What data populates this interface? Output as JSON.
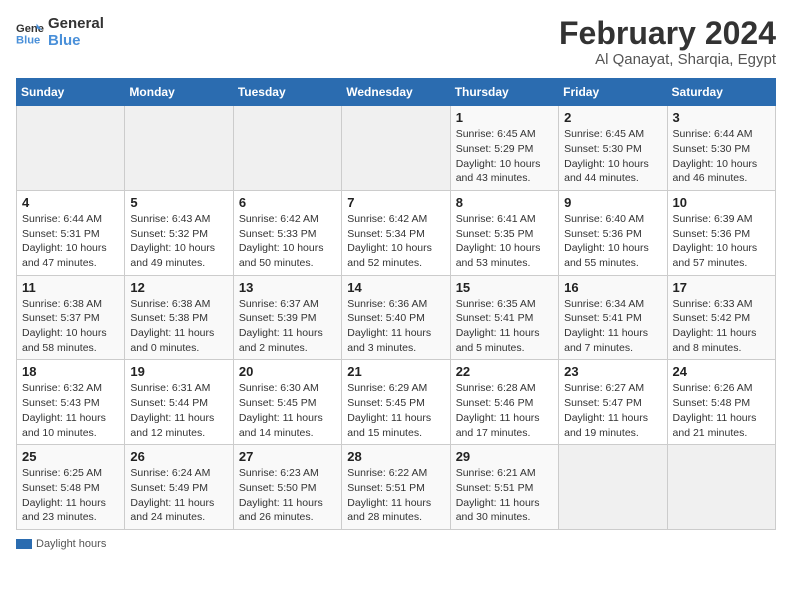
{
  "header": {
    "logo_line1": "General",
    "logo_line2": "Blue",
    "month": "February 2024",
    "location": "Al Qanayat, Sharqia, Egypt"
  },
  "weekdays": [
    "Sunday",
    "Monday",
    "Tuesday",
    "Wednesday",
    "Thursday",
    "Friday",
    "Saturday"
  ],
  "weeks": [
    [
      {
        "day": "",
        "sunrise": "",
        "sunset": "",
        "daylight": ""
      },
      {
        "day": "",
        "sunrise": "",
        "sunset": "",
        "daylight": ""
      },
      {
        "day": "",
        "sunrise": "",
        "sunset": "",
        "daylight": ""
      },
      {
        "day": "",
        "sunrise": "",
        "sunset": "",
        "daylight": ""
      },
      {
        "day": "1",
        "sunrise": "Sunrise: 6:45 AM",
        "sunset": "Sunset: 5:29 PM",
        "daylight": "Daylight: 10 hours and 43 minutes."
      },
      {
        "day": "2",
        "sunrise": "Sunrise: 6:45 AM",
        "sunset": "Sunset: 5:30 PM",
        "daylight": "Daylight: 10 hours and 44 minutes."
      },
      {
        "day": "3",
        "sunrise": "Sunrise: 6:44 AM",
        "sunset": "Sunset: 5:30 PM",
        "daylight": "Daylight: 10 hours and 46 minutes."
      }
    ],
    [
      {
        "day": "4",
        "sunrise": "Sunrise: 6:44 AM",
        "sunset": "Sunset: 5:31 PM",
        "daylight": "Daylight: 10 hours and 47 minutes."
      },
      {
        "day": "5",
        "sunrise": "Sunrise: 6:43 AM",
        "sunset": "Sunset: 5:32 PM",
        "daylight": "Daylight: 10 hours and 49 minutes."
      },
      {
        "day": "6",
        "sunrise": "Sunrise: 6:42 AM",
        "sunset": "Sunset: 5:33 PM",
        "daylight": "Daylight: 10 hours and 50 minutes."
      },
      {
        "day": "7",
        "sunrise": "Sunrise: 6:42 AM",
        "sunset": "Sunset: 5:34 PM",
        "daylight": "Daylight: 10 hours and 52 minutes."
      },
      {
        "day": "8",
        "sunrise": "Sunrise: 6:41 AM",
        "sunset": "Sunset: 5:35 PM",
        "daylight": "Daylight: 10 hours and 53 minutes."
      },
      {
        "day": "9",
        "sunrise": "Sunrise: 6:40 AM",
        "sunset": "Sunset: 5:36 PM",
        "daylight": "Daylight: 10 hours and 55 minutes."
      },
      {
        "day": "10",
        "sunrise": "Sunrise: 6:39 AM",
        "sunset": "Sunset: 5:36 PM",
        "daylight": "Daylight: 10 hours and 57 minutes."
      }
    ],
    [
      {
        "day": "11",
        "sunrise": "Sunrise: 6:38 AM",
        "sunset": "Sunset: 5:37 PM",
        "daylight": "Daylight: 10 hours and 58 minutes."
      },
      {
        "day": "12",
        "sunrise": "Sunrise: 6:38 AM",
        "sunset": "Sunset: 5:38 PM",
        "daylight": "Daylight: 11 hours and 0 minutes."
      },
      {
        "day": "13",
        "sunrise": "Sunrise: 6:37 AM",
        "sunset": "Sunset: 5:39 PM",
        "daylight": "Daylight: 11 hours and 2 minutes."
      },
      {
        "day": "14",
        "sunrise": "Sunrise: 6:36 AM",
        "sunset": "Sunset: 5:40 PM",
        "daylight": "Daylight: 11 hours and 3 minutes."
      },
      {
        "day": "15",
        "sunrise": "Sunrise: 6:35 AM",
        "sunset": "Sunset: 5:41 PM",
        "daylight": "Daylight: 11 hours and 5 minutes."
      },
      {
        "day": "16",
        "sunrise": "Sunrise: 6:34 AM",
        "sunset": "Sunset: 5:41 PM",
        "daylight": "Daylight: 11 hours and 7 minutes."
      },
      {
        "day": "17",
        "sunrise": "Sunrise: 6:33 AM",
        "sunset": "Sunset: 5:42 PM",
        "daylight": "Daylight: 11 hours and 8 minutes."
      }
    ],
    [
      {
        "day": "18",
        "sunrise": "Sunrise: 6:32 AM",
        "sunset": "Sunset: 5:43 PM",
        "daylight": "Daylight: 11 hours and 10 minutes."
      },
      {
        "day": "19",
        "sunrise": "Sunrise: 6:31 AM",
        "sunset": "Sunset: 5:44 PM",
        "daylight": "Daylight: 11 hours and 12 minutes."
      },
      {
        "day": "20",
        "sunrise": "Sunrise: 6:30 AM",
        "sunset": "Sunset: 5:45 PM",
        "daylight": "Daylight: 11 hours and 14 minutes."
      },
      {
        "day": "21",
        "sunrise": "Sunrise: 6:29 AM",
        "sunset": "Sunset: 5:45 PM",
        "daylight": "Daylight: 11 hours and 15 minutes."
      },
      {
        "day": "22",
        "sunrise": "Sunrise: 6:28 AM",
        "sunset": "Sunset: 5:46 PM",
        "daylight": "Daylight: 11 hours and 17 minutes."
      },
      {
        "day": "23",
        "sunrise": "Sunrise: 6:27 AM",
        "sunset": "Sunset: 5:47 PM",
        "daylight": "Daylight: 11 hours and 19 minutes."
      },
      {
        "day": "24",
        "sunrise": "Sunrise: 6:26 AM",
        "sunset": "Sunset: 5:48 PM",
        "daylight": "Daylight: 11 hours and 21 minutes."
      }
    ],
    [
      {
        "day": "25",
        "sunrise": "Sunrise: 6:25 AM",
        "sunset": "Sunset: 5:48 PM",
        "daylight": "Daylight: 11 hours and 23 minutes."
      },
      {
        "day": "26",
        "sunrise": "Sunrise: 6:24 AM",
        "sunset": "Sunset: 5:49 PM",
        "daylight": "Daylight: 11 hours and 24 minutes."
      },
      {
        "day": "27",
        "sunrise": "Sunrise: 6:23 AM",
        "sunset": "Sunset: 5:50 PM",
        "daylight": "Daylight: 11 hours and 26 minutes."
      },
      {
        "day": "28",
        "sunrise": "Sunrise: 6:22 AM",
        "sunset": "Sunset: 5:51 PM",
        "daylight": "Daylight: 11 hours and 28 minutes."
      },
      {
        "day": "29",
        "sunrise": "Sunrise: 6:21 AM",
        "sunset": "Sunset: 5:51 PM",
        "daylight": "Daylight: 11 hours and 30 minutes."
      },
      {
        "day": "",
        "sunrise": "",
        "sunset": "",
        "daylight": ""
      },
      {
        "day": "",
        "sunrise": "",
        "sunset": "",
        "daylight": ""
      }
    ]
  ],
  "legend": {
    "daylight_label": "Daylight hours"
  },
  "colors": {
    "header_bg": "#2b6cb0",
    "accent": "#4a90d9"
  }
}
